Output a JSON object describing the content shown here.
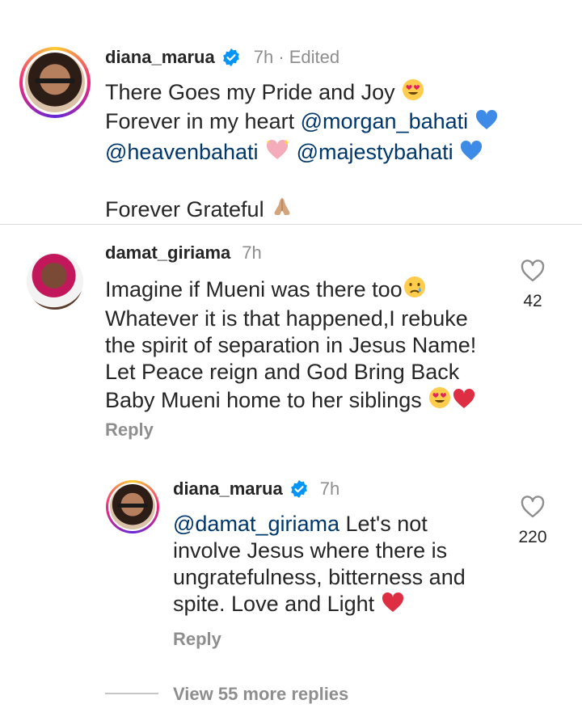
{
  "caption": {
    "username": "diana_marua",
    "meta": "7h · Edited",
    "lines": [
      "There Goes my Pride and Joy",
      "Forever in my heart",
      "Forever Grateful"
    ],
    "mentions": [
      "@morgan_bahati",
      "@heavenbahati",
      "@majestybahati"
    ]
  },
  "comment": {
    "username": "damat_giriama",
    "time": "7h",
    "lines": [
      "Imagine if Mueni was there too",
      "Whatever it is that happened,I rebuke",
      "the spirit of separation in Jesus Name!",
      "Let Peace reign and God Bring Back",
      "Baby Mueni home to her siblings"
    ],
    "likes": "42",
    "reply_label": "Reply"
  },
  "reply": {
    "username": "diana_marua",
    "time": "7h",
    "mention": "@damat_giriama",
    "first_line_rest": " Let's not",
    "lines": [
      "involve Jesus where there is",
      "ungratefulness, bitterness and",
      "spite. Love and Light"
    ],
    "likes": "220",
    "reply_label": "Reply"
  },
  "view_more": "View 55 more replies",
  "colors": {
    "verified": "#0095f6",
    "mention": "#00376b",
    "muted": "#8e8e8e",
    "heart_red": "#ed4956",
    "blue_heart": "#3d8be6"
  }
}
